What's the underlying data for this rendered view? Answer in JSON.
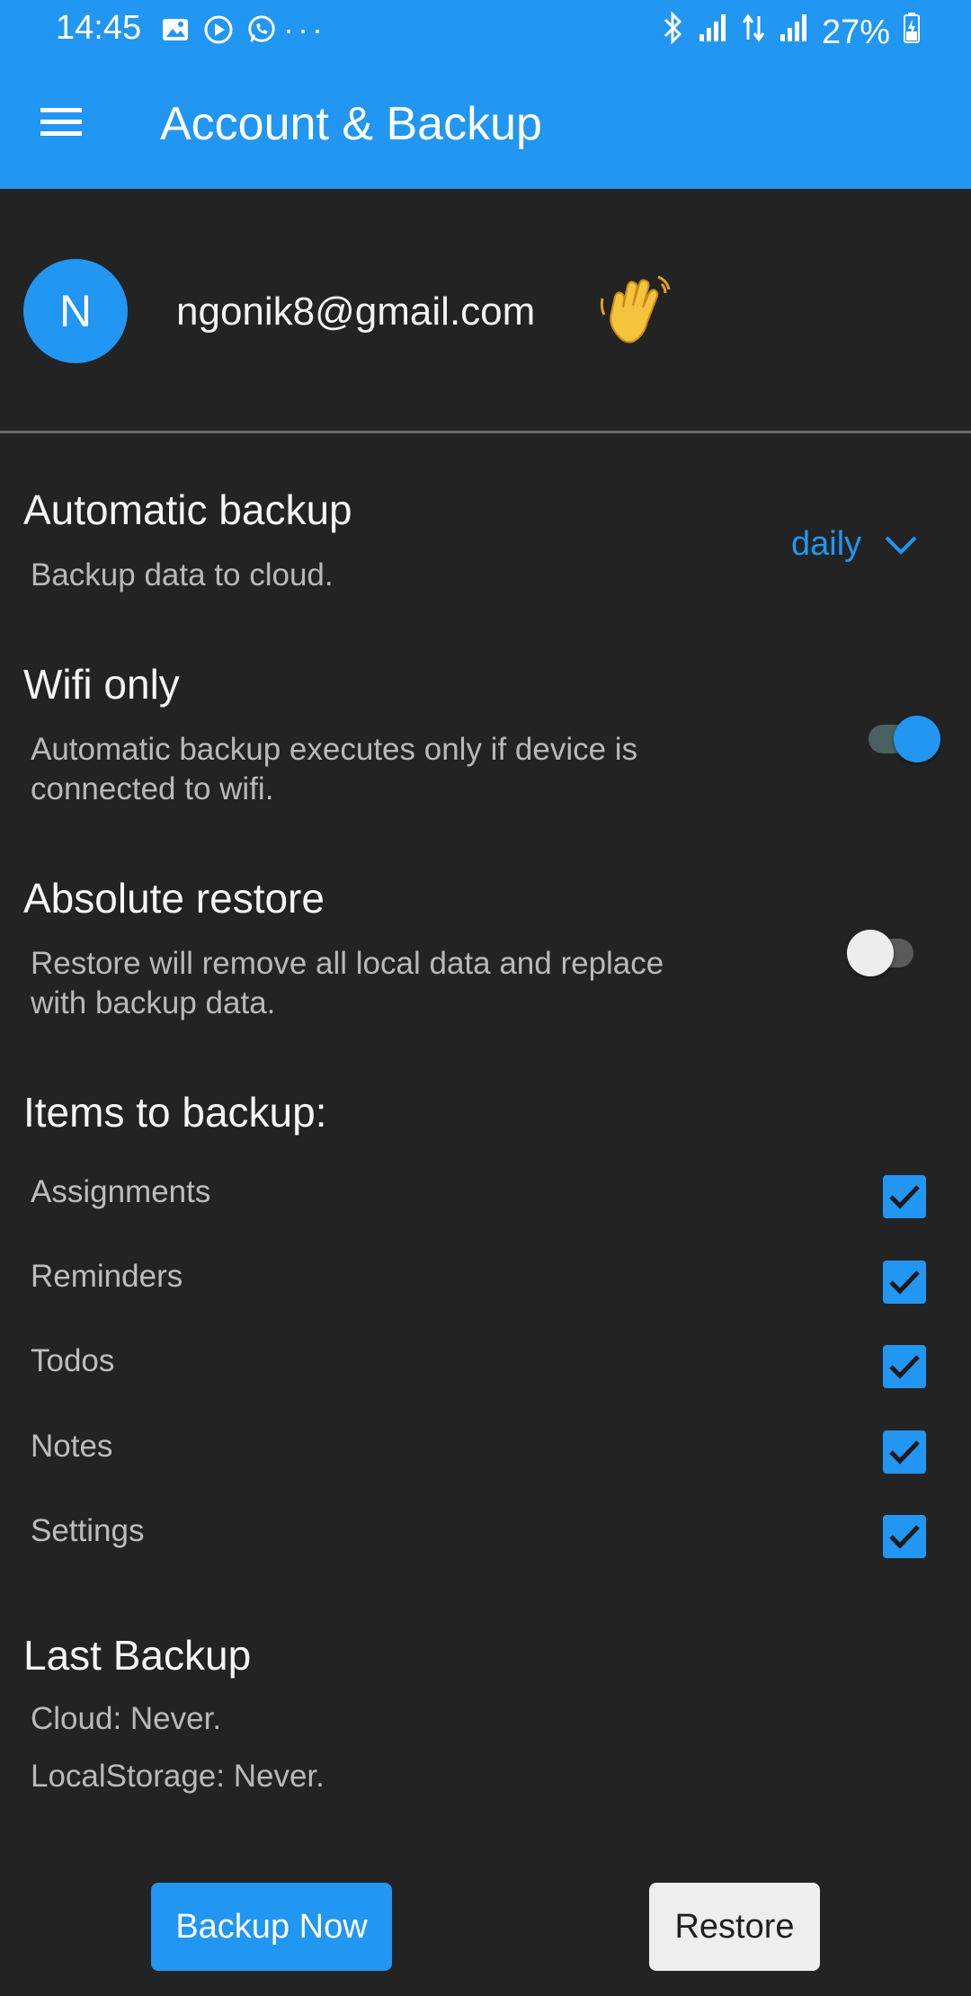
{
  "status_bar": {
    "time": "14:45",
    "battery": "27%",
    "more": "···"
  },
  "header": {
    "title": "Account & Backup"
  },
  "profile": {
    "avatar_letter": "N",
    "email": "ngonik8@gmail.com"
  },
  "automatic_backup": {
    "title": "Automatic backup",
    "subtitle": "Backup data to cloud.",
    "frequency": "daily"
  },
  "wifi_only": {
    "title": "Wifi only",
    "subtitle_line1": "Automatic backup executes only if device is",
    "subtitle_line2": "connected to wifi.",
    "enabled": true
  },
  "absolute_restore": {
    "title": "Absolute restore",
    "subtitle_line1": "Restore will remove all local data and replace",
    "subtitle_line2": "with backup data.",
    "enabled": false
  },
  "items_to_backup": {
    "title": "Items to backup:",
    "items": [
      {
        "label": "Assignments",
        "checked": true
      },
      {
        "label": "Reminders",
        "checked": true
      },
      {
        "label": "Todos",
        "checked": true
      },
      {
        "label": "Notes",
        "checked": true
      },
      {
        "label": "Settings",
        "checked": true
      }
    ]
  },
  "last_backup": {
    "title": "Last Backup",
    "cloud": "Cloud: Never.",
    "local": "LocalStorage: Never."
  },
  "actions": {
    "backup_now": "Backup Now",
    "restore": "Restore"
  },
  "colors": {
    "accent": "#2196F3",
    "background": "#232323"
  },
  "icons": [
    "menu-icon",
    "waving-hand-icon",
    "chevron-down-icon",
    "check-icon",
    "bluetooth-icon",
    "signal-icon",
    "battery-icon"
  ]
}
